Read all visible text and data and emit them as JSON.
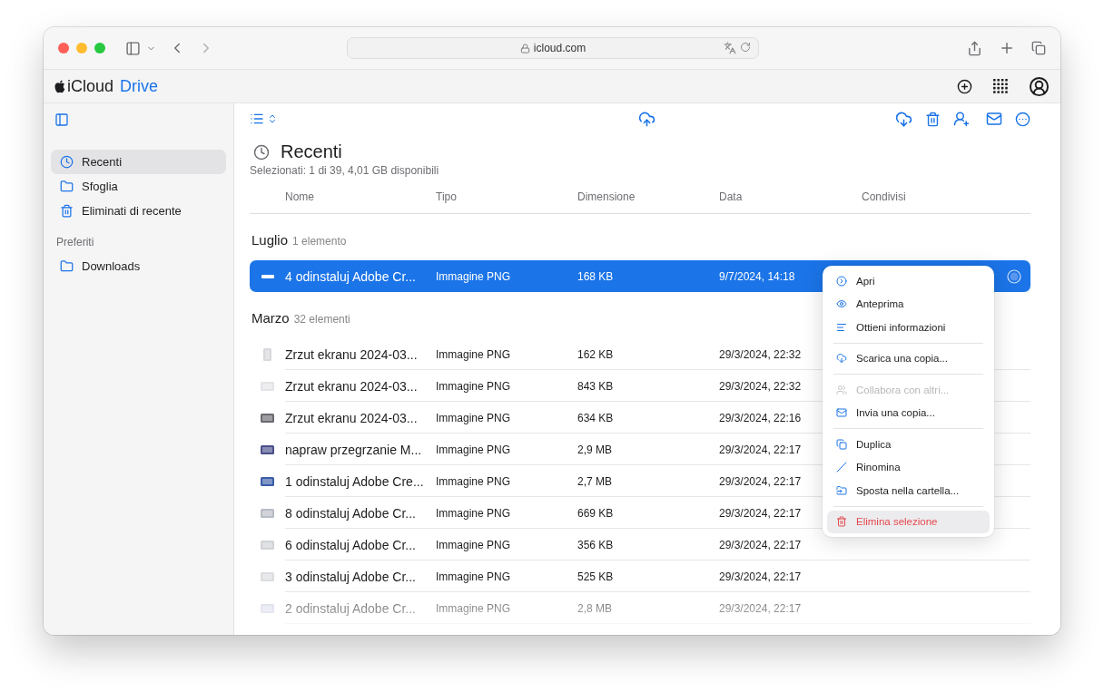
{
  "browser": {
    "url": "icloud.com"
  },
  "app": {
    "brand": "iCloud",
    "product": "Drive"
  },
  "sidebar": {
    "items": [
      {
        "label": "Recenti",
        "kind": "clock",
        "selected": true
      },
      {
        "label": "Sfoglia",
        "kind": "folder",
        "selected": false
      },
      {
        "label": "Eliminati di recente",
        "kind": "trash",
        "selected": false
      }
    ],
    "favorites": {
      "title": "Preferiti",
      "items": [
        {
          "label": "Downloads",
          "kind": "folder",
          "selected": false
        }
      ]
    }
  },
  "main": {
    "title": "Recenti",
    "subtitle": "Selezionati: 1 di 39, 4,01 GB disponibili",
    "columns": [
      "Nome",
      "Tipo",
      "Dimensione",
      "Data",
      "Condivisi"
    ],
    "groups": [
      {
        "title": "Luglio",
        "count": "1 elemento",
        "rows": [
          {
            "name": "4 odinstaluj Adobe Cr...",
            "type": "Immagine PNG",
            "size": "168 KB",
            "date": "9/7/2024, 14:18",
            "selected": true
          }
        ]
      },
      {
        "title": "Marzo",
        "count": "32 elementi",
        "rows": [
          {
            "name": "Zrzut ekranu 2024-03...",
            "type": "Immagine PNG",
            "size": "162 KB",
            "date": "29/3/2024, 22:32",
            "selected": false
          },
          {
            "name": "Zrzut ekranu 2024-03...",
            "type": "Immagine PNG",
            "size": "843 KB",
            "date": "29/3/2024, 22:32",
            "selected": false
          },
          {
            "name": "Zrzut ekranu 2024-03...",
            "type": "Immagine PNG",
            "size": "634 KB",
            "date": "29/3/2024, 22:16",
            "selected": false
          },
          {
            "name": "napraw przegrzanie M...",
            "type": "Immagine PNG",
            "size": "2,9 MB",
            "date": "29/3/2024, 22:17",
            "selected": false
          },
          {
            "name": "1 odinstaluj Adobe Cre...",
            "type": "Immagine PNG",
            "size": "2,7 MB",
            "date": "29/3/2024, 22:17",
            "selected": false
          },
          {
            "name": "8 odinstaluj Adobe Cr...",
            "type": "Immagine PNG",
            "size": "669 KB",
            "date": "29/3/2024, 22:17",
            "selected": false
          },
          {
            "name": "6 odinstaluj Adobe Cr...",
            "type": "Immagine PNG",
            "size": "356 KB",
            "date": "29/3/2024, 22:17",
            "selected": false
          },
          {
            "name": "3 odinstaluj Adobe Cr...",
            "type": "Immagine PNG",
            "size": "525 KB",
            "date": "29/3/2024, 22:17",
            "selected": false
          },
          {
            "name": "2 odinstaluj Adobe Cr...",
            "type": "Immagine PNG",
            "size": "2,8 MB",
            "date": "29/3/2024, 22:17",
            "selected": false
          }
        ]
      }
    ]
  },
  "context_menu": {
    "groups": [
      [
        {
          "label": "Apri",
          "kind": "open",
          "disabled": false,
          "selected": false,
          "danger": false
        },
        {
          "label": "Anteprima",
          "kind": "preview",
          "disabled": false,
          "selected": false,
          "danger": false
        },
        {
          "label": "Ottieni informazioni",
          "kind": "info",
          "disabled": false,
          "selected": false,
          "danger": false
        }
      ],
      [
        {
          "label": "Scarica una copia...",
          "kind": "download",
          "disabled": false,
          "selected": false,
          "danger": false
        }
      ],
      [
        {
          "label": "Collabora con altri...",
          "kind": "collaborate",
          "disabled": true,
          "selected": false,
          "danger": false
        },
        {
          "label": "Invia una copia...",
          "kind": "send",
          "disabled": false,
          "selected": false,
          "danger": false
        }
      ],
      [
        {
          "label": "Duplica",
          "kind": "duplicate",
          "disabled": false,
          "selected": false,
          "danger": false
        },
        {
          "label": "Rinomina",
          "kind": "rename",
          "disabled": false,
          "selected": false,
          "danger": false
        },
        {
          "label": "Sposta nella cartella...",
          "kind": "move",
          "disabled": false,
          "selected": false,
          "danger": false
        }
      ],
      [
        {
          "label": "Elimina selezione",
          "kind": "delete",
          "disabled": false,
          "selected": true,
          "danger": true
        }
      ]
    ]
  }
}
